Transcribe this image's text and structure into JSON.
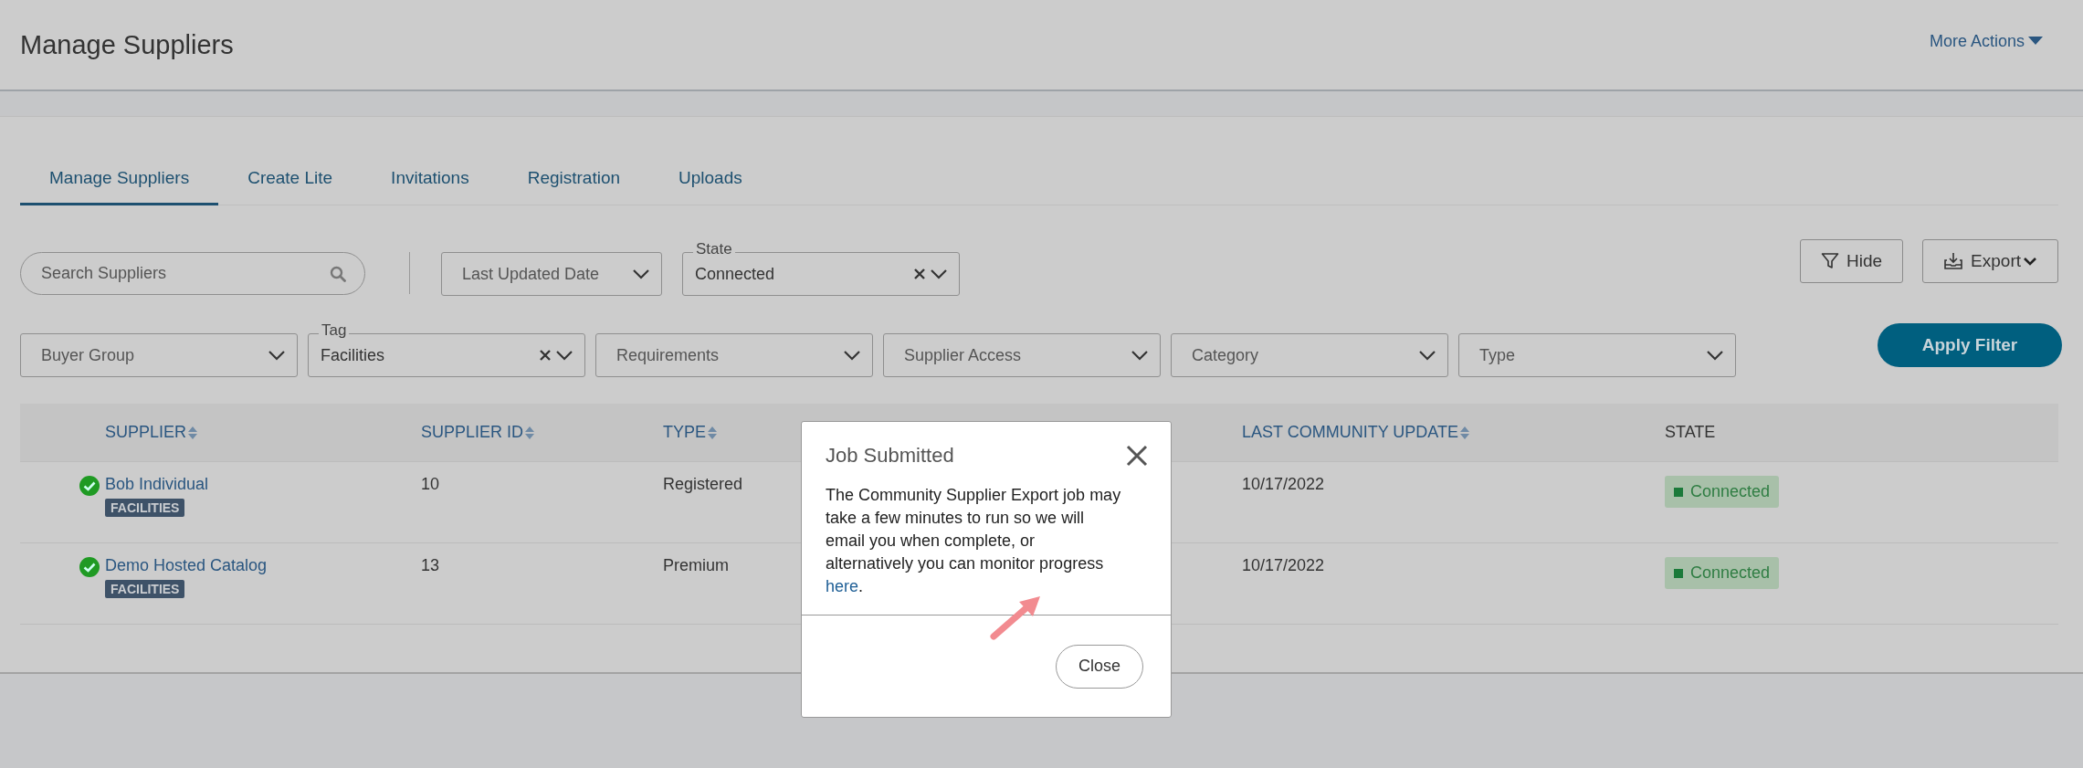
{
  "header": {
    "title": "Manage Suppliers",
    "more_actions": "More Actions"
  },
  "tabs": [
    {
      "label": "Manage Suppliers",
      "selected": true
    },
    {
      "label": "Create Lite",
      "selected": false
    },
    {
      "label": "Invitations",
      "selected": false
    },
    {
      "label": "Registration",
      "selected": false
    },
    {
      "label": "Uploads",
      "selected": false
    }
  ],
  "search": {
    "placeholder": "Search Suppliers"
  },
  "filters_top": [
    {
      "placeholder": "Last Updated Date"
    },
    {
      "label": "State",
      "value": "Connected"
    }
  ],
  "actions": [
    {
      "kind": "filter",
      "label": "Hide"
    },
    {
      "kind": "export",
      "label": "Export"
    }
  ],
  "filters": [
    {
      "placeholder": "Buyer Group"
    },
    {
      "label": "Tag",
      "value": "Facilities"
    },
    {
      "placeholder": "Requirements"
    },
    {
      "placeholder": "Supplier Access"
    },
    {
      "placeholder": "Category"
    },
    {
      "placeholder": "Type"
    }
  ],
  "apply_button": "Apply Filter",
  "table": {
    "columns": [
      {
        "label": "SUPPLIER",
        "sortable": true
      },
      {
        "label": "SUPPLIER ID",
        "sortable": true
      },
      {
        "label": "TYPE",
        "sortable": true
      },
      {
        "label": "LAST COMMUNITY UPDATE",
        "sortable": true
      },
      {
        "label": "STATE",
        "sortable": false
      }
    ],
    "rows": [
      {
        "verified": true,
        "supplier": "Bob Individual",
        "tag": "FACILITIES",
        "supplier_id": "10",
        "type": "Registered",
        "last_community_update": "10/17/2022",
        "state": "Connected"
      },
      {
        "verified": true,
        "supplier": "Demo Hosted Catalog",
        "tag": "FACILITIES",
        "supplier_id": "13",
        "type": "Premium",
        "last_community_update": "10/17/2022",
        "state": "Connected"
      }
    ]
  },
  "dialog": {
    "title": "Job Submitted",
    "message": "The Community Supplier Export job may take a few minutes to run so we will email you when complete, or alternatively you can monitor progress ",
    "link": "here",
    "message_end": ".",
    "close_button": "Close"
  }
}
